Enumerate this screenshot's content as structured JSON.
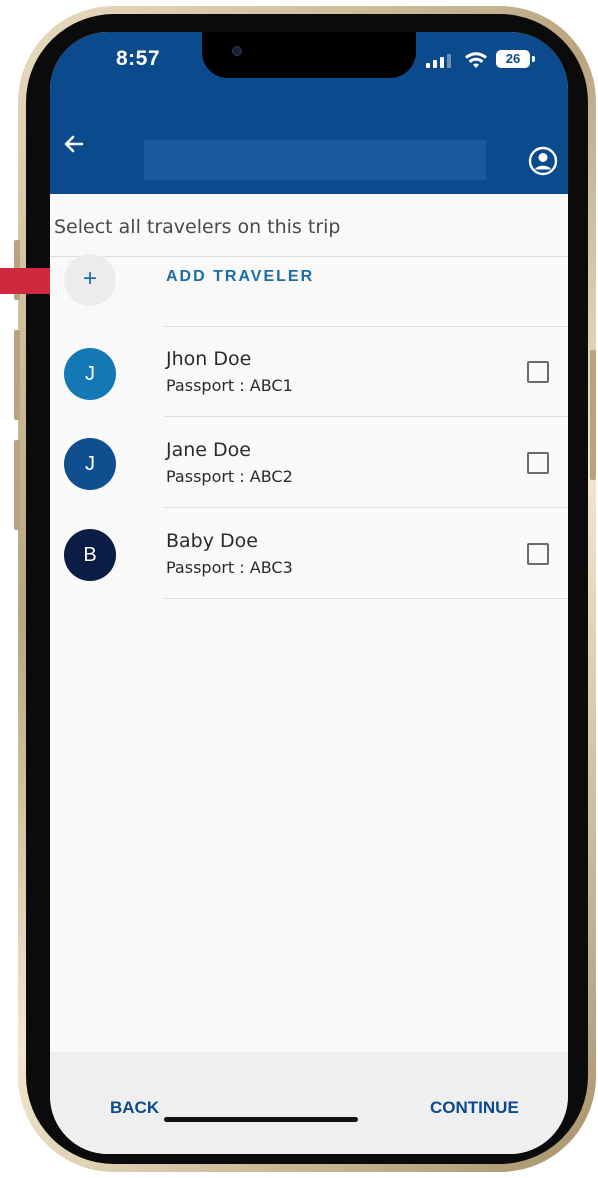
{
  "status_bar": {
    "time": "8:57",
    "battery": "26"
  },
  "app_bar": {
    "title": ""
  },
  "instruction": "Select all travelers on this trip",
  "add_traveler": {
    "icon": "+",
    "label": "ADD TRAVELER"
  },
  "travelers": [
    {
      "initial": "J",
      "name": "Jhon Doe",
      "passport": "Passport : ABC1",
      "color": "#1478b5",
      "checked": false
    },
    {
      "initial": "J",
      "name": "Jane Doe",
      "passport": "Passport : ABC2",
      "color": "#0f4f8f",
      "checked": false
    },
    {
      "initial": "B",
      "name": "Baby Doe",
      "passport": "Passport : ABC3",
      "color": "#0b1d45",
      "checked": false
    }
  ],
  "footer": {
    "back_label": "BACK",
    "continue_label": "CONTINUE"
  },
  "colors": {
    "primary": "#0b4a8c",
    "accent": "#1c6da7",
    "marker": "#d0283c"
  }
}
